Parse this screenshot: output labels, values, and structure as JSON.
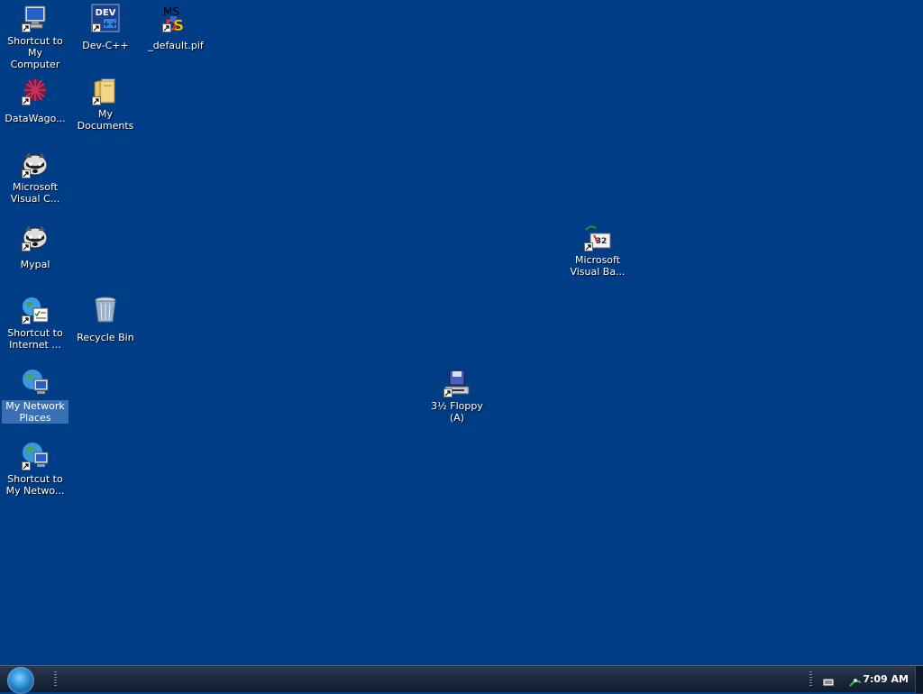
{
  "desktop": {
    "icons": [
      {
        "label": "Shortcut to My Computer",
        "icon": "computer-icon"
      },
      {
        "label": "Dev-C++",
        "icon": "devcpp-icon"
      },
      {
        "label": "_default.pif",
        "icon": "msdos-icon"
      },
      {
        "label": "DataWago...",
        "icon": "datawagon-icon"
      },
      {
        "label": "My Documents",
        "icon": "folder-icon"
      },
      {
        "label": "Microsoft Visual C...",
        "icon": "raccoon-icon"
      },
      {
        "label": "Mypal",
        "icon": "raccoon-icon"
      },
      {
        "label": "Shortcut to Internet ...",
        "icon": "internet-icon"
      },
      {
        "label": "Recycle Bin",
        "icon": "recycle-bin-icon"
      },
      {
        "label": "My Network Places",
        "icon": "network-icon"
      },
      {
        "label": "Shortcut to My Netwo...",
        "icon": "network-icon"
      },
      {
        "label": "3½ Floppy (A)",
        "icon": "floppy-drive-icon"
      },
      {
        "label": "Microsoft Visual Ba...",
        "icon": "vb-icon"
      }
    ]
  },
  "taskbar": {
    "clock": "7:09 AM",
    "tray_icons": [
      "keyboard-icon",
      "network-tray-icon"
    ]
  }
}
